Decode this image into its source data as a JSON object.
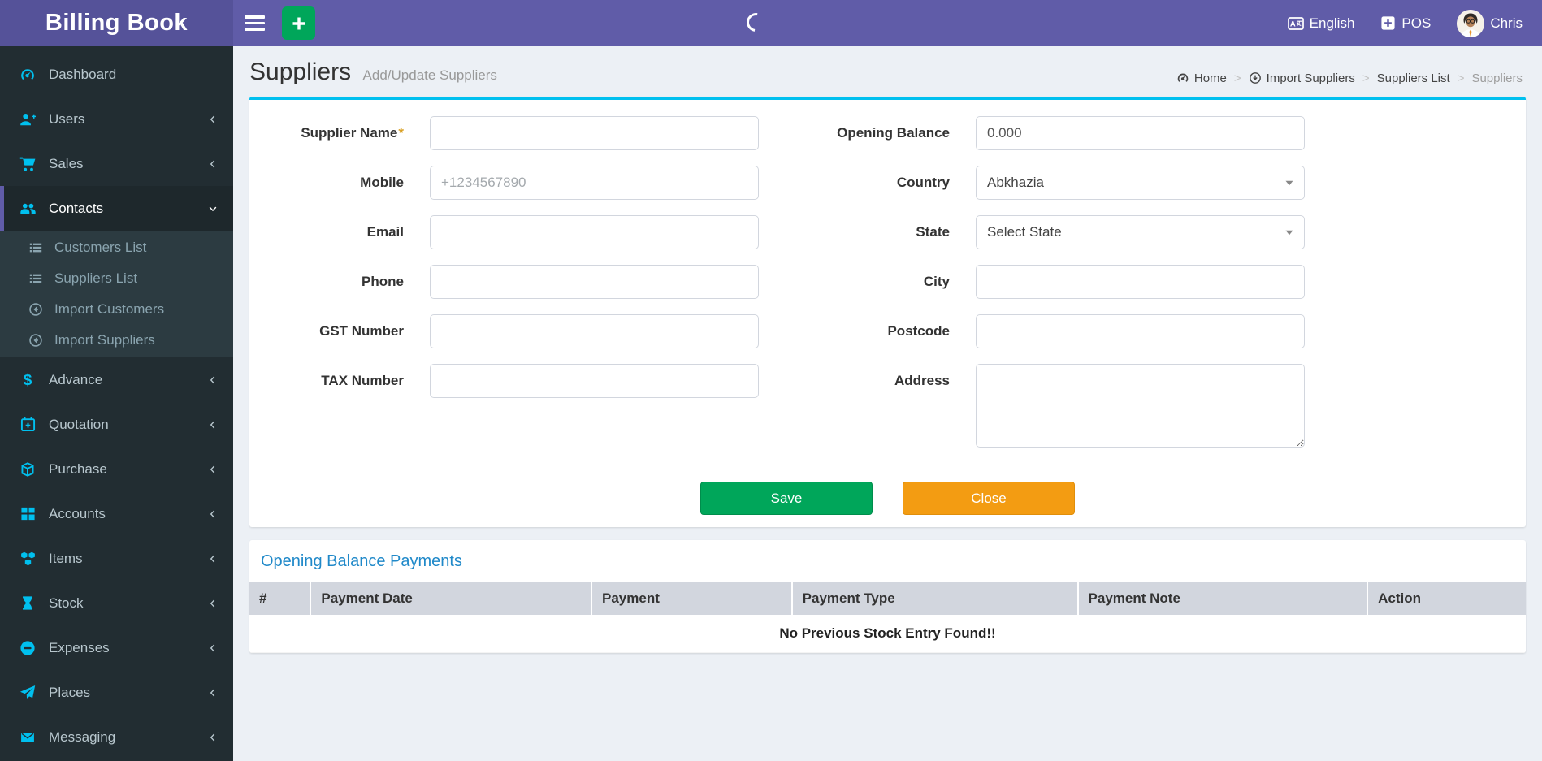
{
  "app": {
    "title": "Billing Book"
  },
  "navbar": {
    "language": "English",
    "pos_label": "POS",
    "username": "Chris"
  },
  "sidebar": {
    "items": [
      {
        "label": "Dashboard",
        "icon": "dashboard-icon"
      },
      {
        "label": "Users",
        "icon": "user-plus-icon"
      },
      {
        "label": "Sales",
        "icon": "cart-icon"
      },
      {
        "label": "Contacts",
        "icon": "users-icon",
        "active": true,
        "expanded": true
      },
      {
        "label": "Advance",
        "icon": "dollar-icon"
      },
      {
        "label": "Quotation",
        "icon": "calendar-icon"
      },
      {
        "label": "Purchase",
        "icon": "cube-icon"
      },
      {
        "label": "Accounts",
        "icon": "grid-icon"
      },
      {
        "label": "Items",
        "icon": "cubes-icon"
      },
      {
        "label": "Stock",
        "icon": "hourglass-icon"
      },
      {
        "label": "Expenses",
        "icon": "minus-circle-icon"
      },
      {
        "label": "Places",
        "icon": "paper-plane-icon"
      },
      {
        "label": "Messaging",
        "icon": "envelope-icon"
      }
    ],
    "contacts_submenu": [
      {
        "label": "Customers List",
        "icon": "list-icon"
      },
      {
        "label": "Suppliers List",
        "icon": "list-icon"
      },
      {
        "label": "Import Customers",
        "icon": "arrow-circle-left-icon"
      },
      {
        "label": "Import Suppliers",
        "icon": "arrow-circle-left-icon"
      }
    ]
  },
  "page": {
    "title": "Suppliers",
    "subtitle": "Add/Update Suppliers",
    "breadcrumb": [
      {
        "label": "Home",
        "icon": "dashboard-icon"
      },
      {
        "label": "Import Suppliers",
        "icon": "arrow-circle-down-icon"
      },
      {
        "label": "Suppliers List"
      },
      {
        "label": "Suppliers",
        "muted": true
      }
    ]
  },
  "form": {
    "fields": {
      "supplier_name": {
        "label": "Supplier Name",
        "required_mark": "*",
        "value": ""
      },
      "mobile": {
        "label": "Mobile",
        "placeholder": "+1234567890",
        "value": ""
      },
      "email": {
        "label": "Email",
        "value": ""
      },
      "phone": {
        "label": "Phone",
        "value": ""
      },
      "gst_number": {
        "label": "GST Number",
        "value": ""
      },
      "tax_number": {
        "label": "TAX Number",
        "value": ""
      },
      "opening_balance": {
        "label": "Opening Balance",
        "value": "0.000"
      },
      "country": {
        "label": "Country",
        "selected": "Abkhazia"
      },
      "state": {
        "label": "State",
        "selected": "Select State"
      },
      "city": {
        "label": "City",
        "value": ""
      },
      "postcode": {
        "label": "Postcode",
        "value": ""
      },
      "address": {
        "label": "Address",
        "value": ""
      }
    },
    "buttons": {
      "save": "Save",
      "close": "Close"
    }
  },
  "payments": {
    "title": "Opening Balance Payments",
    "columns": [
      "#",
      "Payment Date",
      "Payment",
      "Payment Type",
      "Payment Note",
      "Action"
    ],
    "empty_message": "No Previous Stock Entry Found!!"
  },
  "colors": {
    "navbar_purple": "#605ca8",
    "logo_purple": "#555299",
    "info_cyan": "#00c0ef",
    "save_green": "#00a65a",
    "close_orange": "#f39c12",
    "section_title_blue": "#2089c9"
  }
}
